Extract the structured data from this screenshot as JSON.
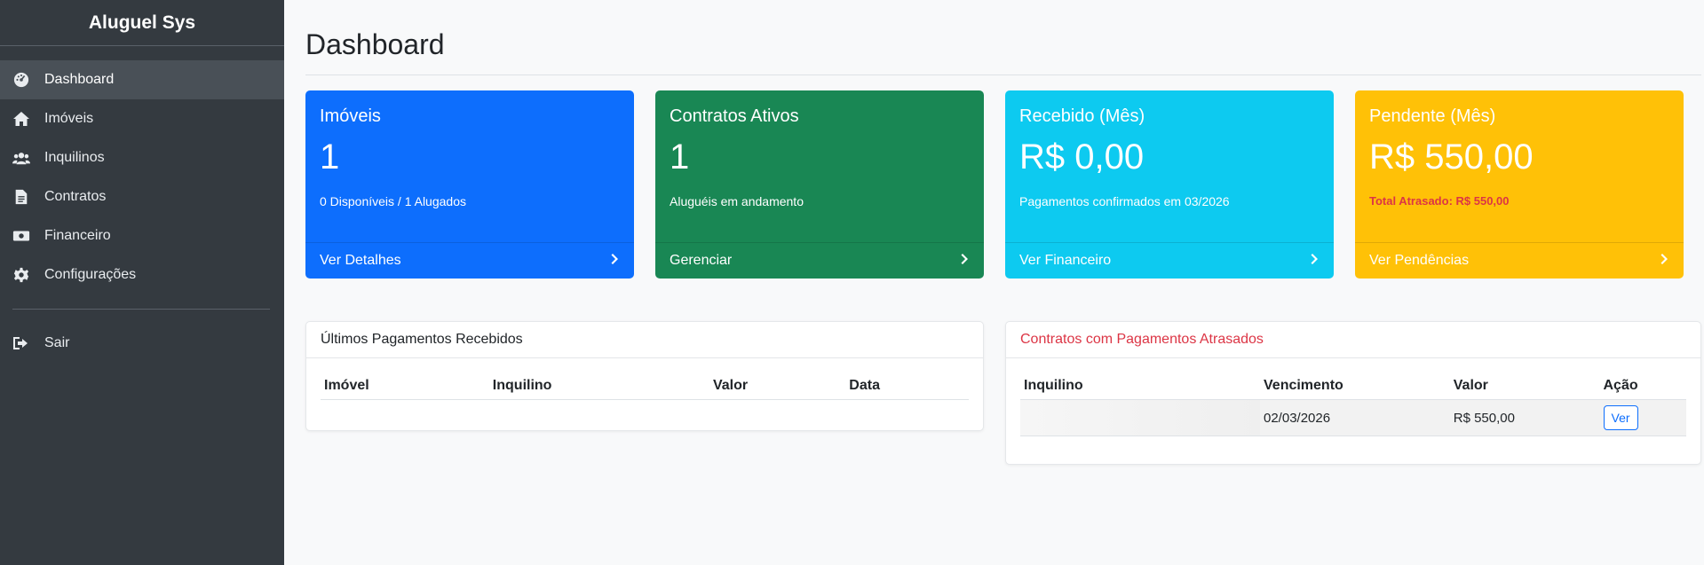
{
  "app": {
    "title": "Aluguel Sys"
  },
  "sidebar": {
    "items": [
      {
        "label": "Dashboard",
        "icon": "gauge-icon"
      },
      {
        "label": "Imóveis",
        "icon": "home-icon"
      },
      {
        "label": "Inquilinos",
        "icon": "users-icon"
      },
      {
        "label": "Contratos",
        "icon": "file-icon"
      },
      {
        "label": "Financeiro",
        "icon": "money-icon"
      },
      {
        "label": "Configurações",
        "icon": "gear-icon"
      }
    ],
    "logout": {
      "label": "Sair",
      "icon": "sign-out-icon"
    },
    "active_index": 0
  },
  "page": {
    "title": "Dashboard"
  },
  "cards": [
    {
      "title": "Imóveis",
      "value": "1",
      "sub": "0 Disponíveis / 1 Alugados",
      "link": "Ver Detalhes",
      "color": "#0d6efd"
    },
    {
      "title": "Contratos Ativos",
      "value": "1",
      "sub": "Aluguéis em andamento",
      "link": "Gerenciar",
      "color": "#198754"
    },
    {
      "title": "Recebido (Mês)",
      "value": "R$ 0,00",
      "sub": "Pagamentos confirmados em 03/2026",
      "link": "Ver Financeiro",
      "color": "#0dcaf0"
    },
    {
      "title": "Pendente (Mês)",
      "value": "R$ 550,00",
      "sub": "Total Atrasado: R$ 550,00",
      "link": "Ver Pendências",
      "color": "#ffc107"
    }
  ],
  "payments_panel": {
    "title": "Últimos Pagamentos Recebidos",
    "columns": [
      "Imóvel",
      "Inquilino",
      "Valor",
      "Data"
    ]
  },
  "overdue_panel": {
    "title": "Contratos com Pagamentos Atrasados",
    "columns": [
      "Inquilino",
      "Vencimento",
      "Valor",
      "Ação"
    ],
    "rows": [
      {
        "inquilino": "",
        "vencimento": "02/03/2026",
        "valor": "R$ 550,00",
        "acao": "Ver"
      }
    ]
  },
  "colors": {
    "sidebar_bg": "#343a40",
    "danger": "#dc3545"
  }
}
